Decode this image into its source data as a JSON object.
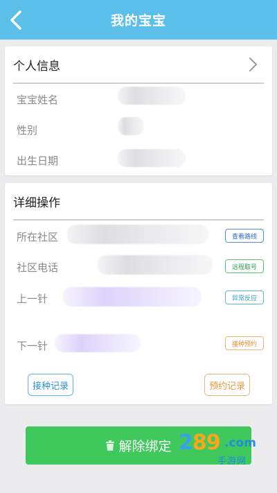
{
  "header": {
    "title": "我的宝宝"
  },
  "personal": {
    "title": "个人信息",
    "fields": [
      {
        "label": "宝宝姓名"
      },
      {
        "label": "性别"
      },
      {
        "label": "出生日期"
      }
    ]
  },
  "detail": {
    "title": "详细操作",
    "rows": [
      {
        "label": "所在社区",
        "action": "查看路线"
      },
      {
        "label": "社区电话",
        "action": "远程取号"
      },
      {
        "label": "上一针",
        "action": "异常反应"
      },
      {
        "label": "下一针",
        "action": "接种预约"
      }
    ],
    "vaccination_record": "接种记录",
    "appointment_record": "预约记录"
  },
  "unbind_label": "解除绑定",
  "watermark": {
    "num_a": "2",
    "num_b": "89",
    "dot_com": ".com",
    "sub": "手游网"
  },
  "colors": {
    "header": "#5bbfea",
    "unbind": "#3fc85c",
    "tag_blue": "#4f8fe0",
    "tag_green": "#4ec46a",
    "tag_cyan": "#53b7e6",
    "tag_orange": "#f0b46a"
  }
}
